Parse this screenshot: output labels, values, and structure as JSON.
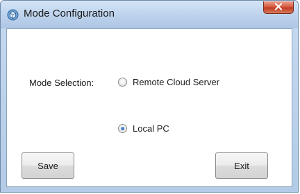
{
  "window": {
    "title": "Mode Configuration"
  },
  "form": {
    "mode_label": "Mode Selection:",
    "options": [
      {
        "label": "Remote Cloud Server",
        "selected": false
      },
      {
        "label": "Local PC",
        "selected": true
      }
    ]
  },
  "buttons": {
    "save_label": "Save",
    "exit_label": "Exit"
  },
  "icons": {
    "app": "gear-globe-icon",
    "close": "close-icon"
  },
  "colors": {
    "titlebar": "#bcd2ec",
    "close_button": "#d55b42",
    "radio_selected": "#1e5fae"
  }
}
